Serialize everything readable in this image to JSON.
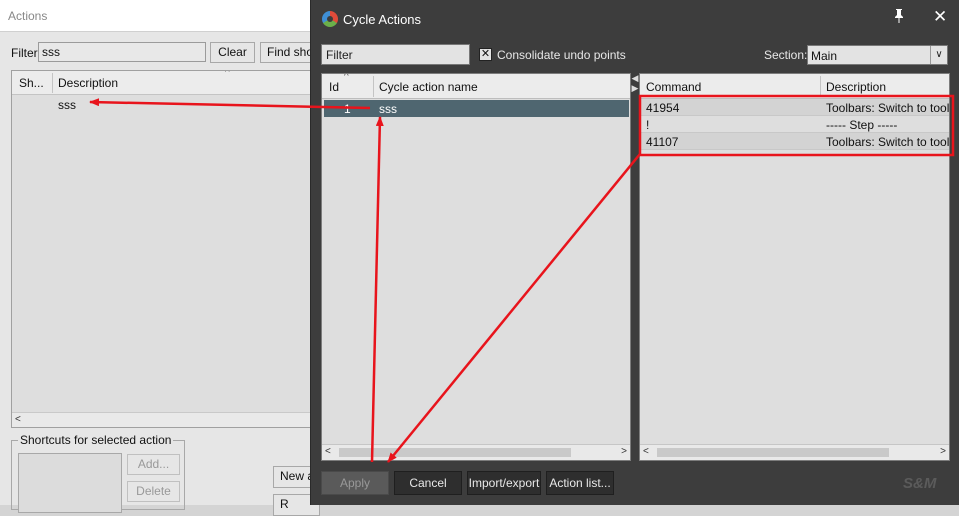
{
  "actions_window": {
    "title": "Actions",
    "filter_label": "Filter:",
    "filter_value": "sss",
    "clear_label": "Clear",
    "find_shortcut_label": "Find short",
    "columns": [
      "Sh...",
      "Description"
    ],
    "rows": [
      {
        "description": "sss"
      }
    ],
    "shortcuts_group_label": "Shortcuts for selected action",
    "add_label": "Add...",
    "delete_label": "Delete",
    "new_action_label": "New a",
    "r_label": "R"
  },
  "cycle_dialog": {
    "title": "Cycle Actions",
    "filter_placeholder": "Filter",
    "consolidate_label": "Consolidate undo points",
    "consolidate_checked": true,
    "section_label": "Section:",
    "section_value": "Main",
    "left_columns": [
      "Id",
      "Cycle action name"
    ],
    "cycle_actions": [
      {
        "id": "1",
        "name": "sss"
      }
    ],
    "right_columns": [
      "Command",
      "Description"
    ],
    "commands": [
      {
        "command": "41954",
        "description": "Toolbars: Switch to toolba"
      },
      {
        "command": "!",
        "description": "----- Step -----"
      },
      {
        "command": "41107",
        "description": "Toolbars: Switch to toolba"
      }
    ],
    "buttons": {
      "apply": "Apply",
      "cancel": "Cancel",
      "import_export": "Import/export",
      "action_list": "Action list..."
    },
    "brand": "S&M"
  },
  "annotation_color": "#e8141c"
}
